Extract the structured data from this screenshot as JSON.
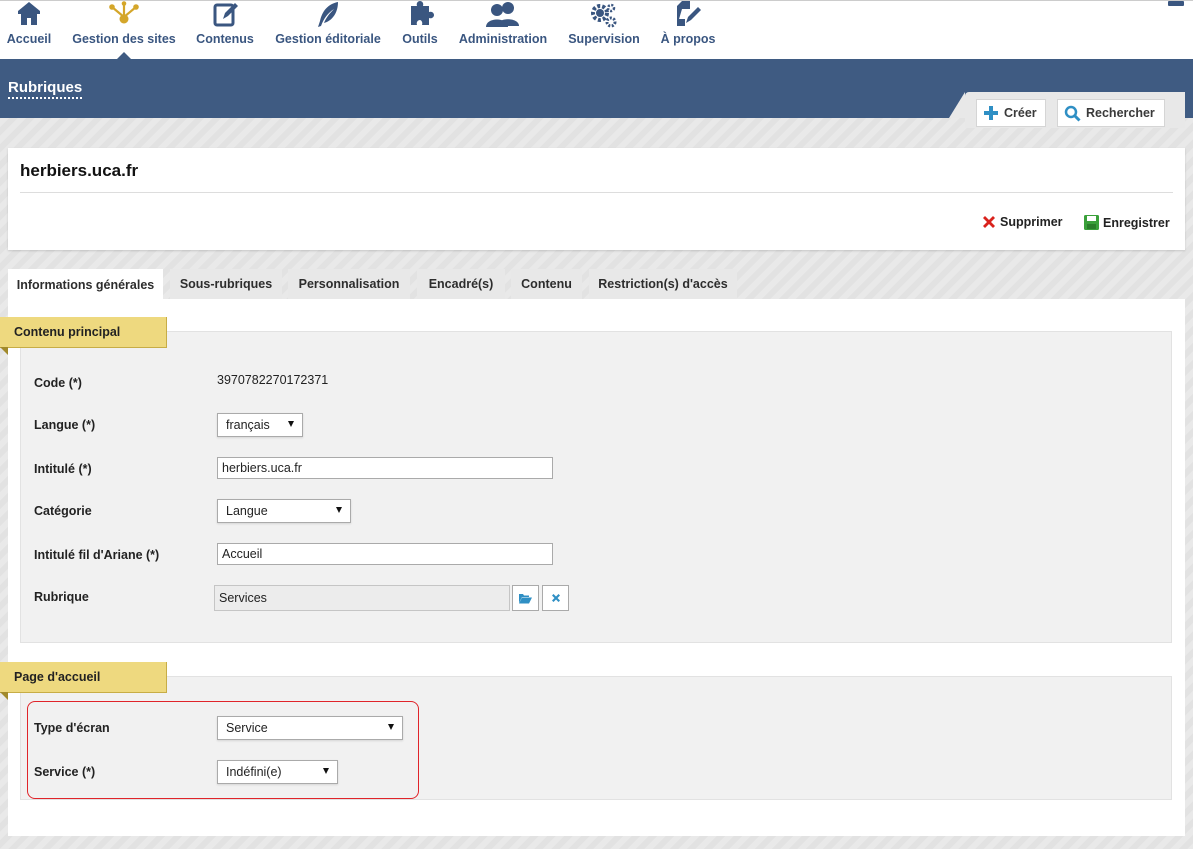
{
  "nav": {
    "items": [
      {
        "label": "Accueil",
        "icon": "home-icon"
      },
      {
        "label": "Gestion des sites",
        "icon": "sitemap-icon"
      },
      {
        "label": "Contenus",
        "icon": "edit-icon"
      },
      {
        "label": "Gestion éditoriale",
        "icon": "feather-icon"
      },
      {
        "label": "Outils",
        "icon": "puzzle-icon"
      },
      {
        "label": "Administration",
        "icon": "users-icon"
      },
      {
        "label": "Supervision",
        "icon": "gears-icon"
      },
      {
        "label": "À propos",
        "icon": "pen-icon"
      }
    ],
    "active_index": 1
  },
  "section": {
    "title": "Rubriques"
  },
  "toolbar": {
    "create_label": "Créer",
    "search_label": "Rechercher"
  },
  "header": {
    "title": "herbiers.uca.fr",
    "delete_label": "Supprimer",
    "save_label": "Enregistrer"
  },
  "tabs": [
    "Informations générales",
    "Sous-rubriques",
    "Personnalisation",
    "Encadré(s)",
    "Contenu",
    "Restriction(s) d'accès"
  ],
  "active_tab": 0,
  "main_content": {
    "legend": "Contenu principal",
    "code": {
      "label": "Code (*)",
      "value": "3970782270172371"
    },
    "langue": {
      "label": "Langue (*)",
      "value": "français"
    },
    "intitule": {
      "label": "Intitulé (*)",
      "value": "herbiers.uca.fr"
    },
    "categorie": {
      "label": "Catégorie",
      "value": "Langue"
    },
    "fil_ariane": {
      "label": "Intitulé fil d'Ariane (*)",
      "value": "Accueil"
    },
    "rubrique": {
      "label": "Rubrique",
      "value": "Services"
    }
  },
  "home_page": {
    "legend": "Page d'accueil",
    "type_ecran": {
      "label": "Type d'écran",
      "value": "Service"
    },
    "service": {
      "label": "Service (*)",
      "value": "Indéfini(e)"
    }
  },
  "colors": {
    "nav_text": "#3a5680",
    "band": "#3f5b82",
    "active_icon": "#d4a62a",
    "legend_bg": "#eed97f",
    "delete": "#d9221c",
    "save": "#3aa03a",
    "highlight": "#e0242a"
  }
}
